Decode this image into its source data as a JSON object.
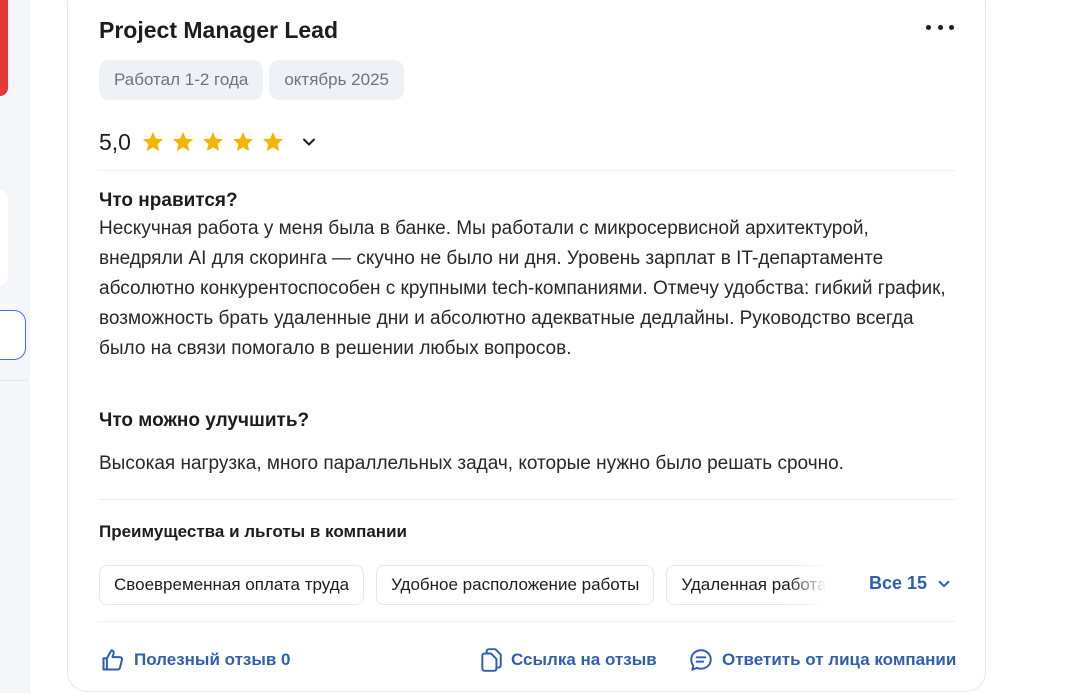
{
  "review": {
    "title": "Project Manager Lead",
    "tags": [
      "Работал 1-2 года",
      "октябрь 2025"
    ],
    "rating": "5,0",
    "stars": 5,
    "star_color": "#f5b400",
    "likes_title": "Что нравится?",
    "likes_text": "Нескучная работа у меня была в банке. Мы работали с микросервисной архитектурой, внедряли AI для скоринга — скучно не было ни дня. Уровень зарплат в IT-департаменте абсолютно конкурентоспособен с крупными tech-компаниями. Отмечу удобства: гибкий график, возможность брать удаленные дни и абсолютно адекватные дедлайны. Руководство всегда было на связи помогало в решении любых вопросов.",
    "improve_title": "Что можно улучшить?",
    "improve_text": "Высокая нагрузка, много параллельных задач, которые нужно было решать срочно."
  },
  "perks": {
    "title": "Преимущества и льготы в компании",
    "items": [
      "Своевременная оплата труда",
      "Удобное расположение работы",
      "Удаленная работа"
    ],
    "all_label": "Все 15"
  },
  "actions": {
    "helpful": "Полезный отзыв 0",
    "link": "Ссылка на отзыв",
    "reply": "Ответить от лица компании"
  },
  "colors": {
    "accent": "#2f5fb3",
    "sidebar_red": "#e53935",
    "tag_bg": "#eef1f6"
  },
  "icons": [
    "more-dots-icon",
    "star-icon",
    "chevron-down-icon",
    "thumbs-up-icon",
    "copy-link-icon",
    "chat-bubble-icon"
  ]
}
